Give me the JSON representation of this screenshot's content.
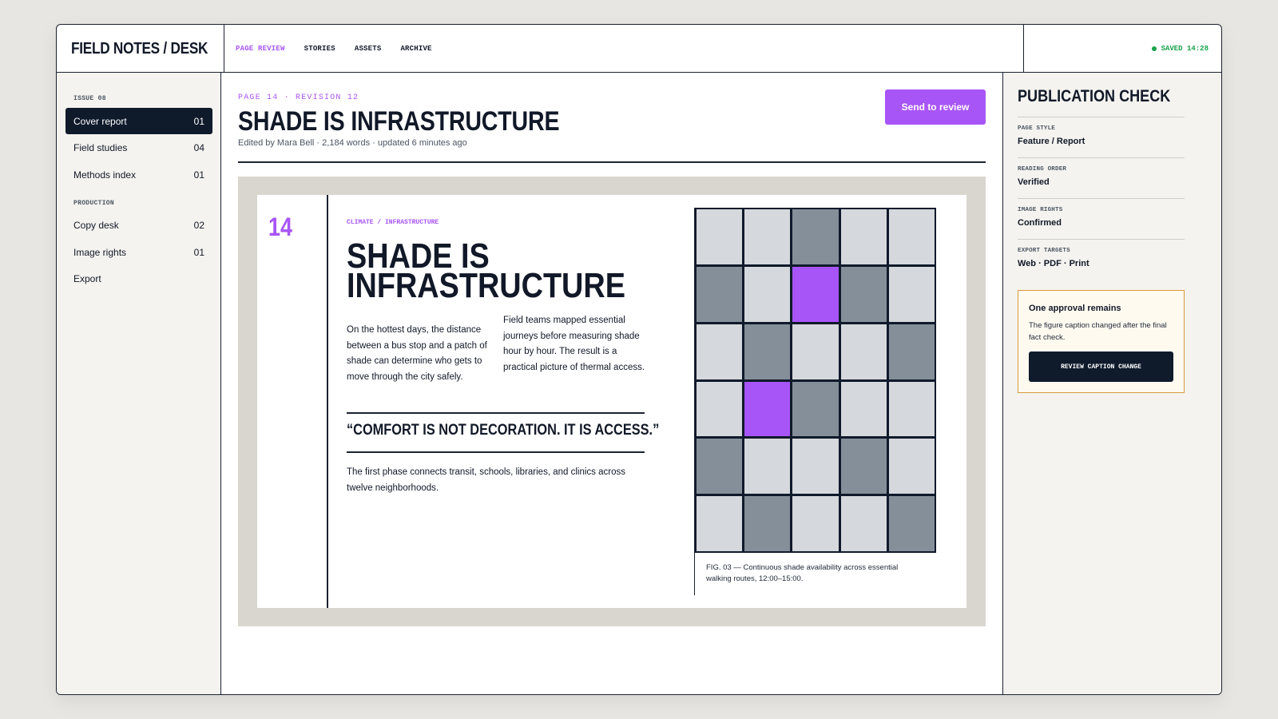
{
  "app": {
    "brand": "FIELD NOTES / DESK",
    "saved_status": "SAVED 14:28",
    "status_color": "#16a34a"
  },
  "nav": {
    "items": [
      {
        "label": "PAGE REVIEW",
        "active": true
      },
      {
        "label": "STORIES",
        "active": false
      },
      {
        "label": "ASSETS",
        "active": false
      },
      {
        "label": "ARCHIVE",
        "active": false
      }
    ]
  },
  "sidebar": {
    "group_issue": "ISSUE 08",
    "group_production": "PRODUCTION",
    "items": [
      {
        "label": "Cover report",
        "count": "01",
        "active": true
      },
      {
        "label": "Field studies",
        "count": "04",
        "active": false
      },
      {
        "label": "Methods index",
        "count": "01",
        "active": false
      },
      {
        "label": "Copy desk",
        "count": "02",
        "active": false
      },
      {
        "label": "Image rights",
        "count": "01",
        "active": false
      },
      {
        "label": "Export",
        "count": "",
        "active": false
      }
    ]
  },
  "main": {
    "crumb": "PAGE 14 · REVISION 12",
    "title": "SHADE IS INFRASTRUCTURE",
    "meta": "Edited by Mara Bell · 2,184 words · updated 6 minutes ago",
    "send_button": "Send to review"
  },
  "page": {
    "number": "14",
    "kicker": "CLIMATE / INFRASTRUCTURE",
    "headline_line1": "SHADE IS",
    "headline_line2": "INFRASTRUCTURE",
    "col1": "On the hottest days, the distance between a bus stop and a patch of shade can determine who gets to move through the city safely.",
    "col2": "Field teams mapped essential journeys before measuring shade hour by hour. The result is a practical picture of thermal access.",
    "quote": "“COMFORT IS NOT DECORATION. IT IS ACCESS.”",
    "lower": "The first phase connects transit, schools, libraries, and clinics across twelve neighborhoods.",
    "figure_caption": "FIG. 03 — Continuous shade availability across essential walking routes, 12:00–15:00.",
    "figure_grid": [
      [
        "light",
        "light",
        "dark",
        "light",
        "light"
      ],
      [
        "dark",
        "light",
        "accent",
        "dark",
        "light"
      ],
      [
        "light",
        "dark",
        "light",
        "light",
        "dark"
      ],
      [
        "light",
        "accent",
        "dark",
        "light",
        "light"
      ],
      [
        "dark",
        "light",
        "light",
        "dark",
        "light"
      ],
      [
        "light",
        "dark",
        "light",
        "light",
        "dark"
      ]
    ],
    "colors": {
      "accent": "#a855f7",
      "dark": "#858f99",
      "light": "#d5d8dc",
      "ink": "#0f1a2b"
    }
  },
  "panel": {
    "title": "PUBLICATION CHECK",
    "checks": [
      {
        "label": "PAGE STYLE",
        "value": "Feature / Report"
      },
      {
        "label": "READING ORDER",
        "value": "Verified"
      },
      {
        "label": "IMAGE RIGHTS",
        "value": "Confirmed"
      },
      {
        "label": "EXPORT TARGETS",
        "value": "Web · PDF · Print"
      }
    ],
    "alert": {
      "title": "One approval remains",
      "text": "The figure caption changed after the final fact check.",
      "button": "REVIEW CAPTION CHANGE"
    }
  }
}
